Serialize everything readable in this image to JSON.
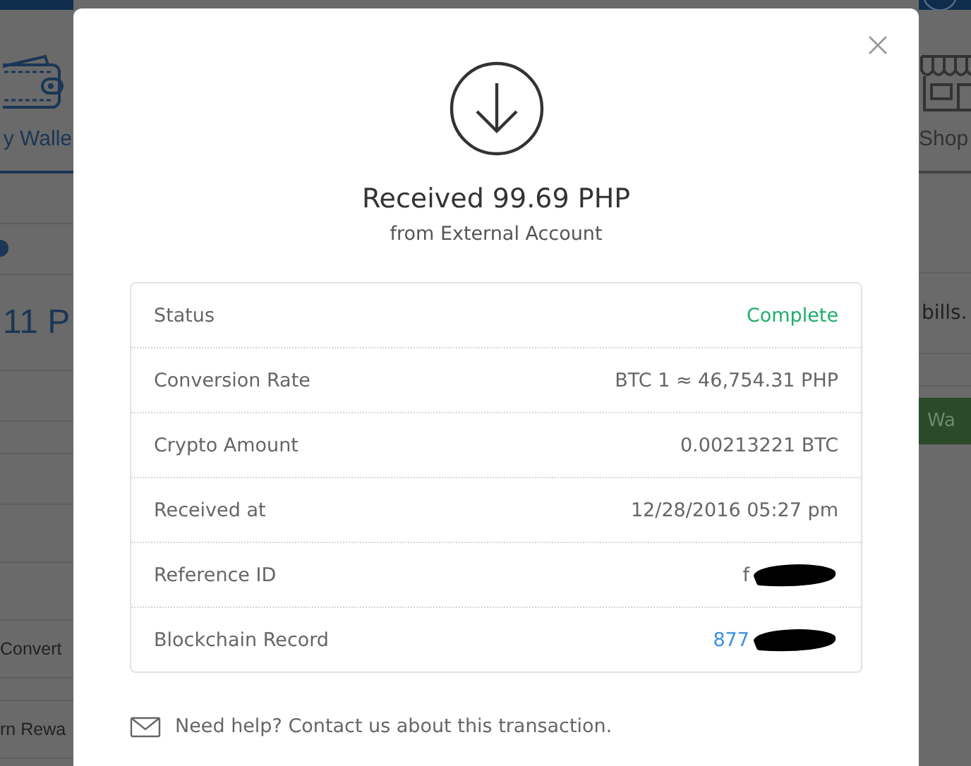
{
  "background": {
    "left": {
      "nav_label": "y Walle",
      "balance": "11 P",
      "items": [
        "Convert",
        "rn Rewa"
      ]
    },
    "right": {
      "nav_label": "Shop",
      "notice": "bills.",
      "button": "Wa"
    }
  },
  "modal": {
    "title": "Received 99.69 PHP",
    "subtitle": "from External Account",
    "rows": [
      {
        "label": "Status",
        "value": "Complete",
        "kind": "status",
        "redacted": false
      },
      {
        "label": "Conversion Rate",
        "value": "BTC 1 ≈ 46,754.31 PHP",
        "kind": "text",
        "redacted": false
      },
      {
        "label": "Crypto Amount",
        "value": "0.00213221 BTC",
        "kind": "text",
        "redacted": false
      },
      {
        "label": "Received at",
        "value": "12/28/2016 05:27 pm",
        "kind": "text",
        "redacted": false
      },
      {
        "label": "Reference ID",
        "value": "f",
        "kind": "text",
        "redacted": true
      },
      {
        "label": "Blockchain Record",
        "value": "877",
        "kind": "link",
        "redacted": true
      }
    ],
    "help": "Need help? Contact us about this transaction."
  }
}
